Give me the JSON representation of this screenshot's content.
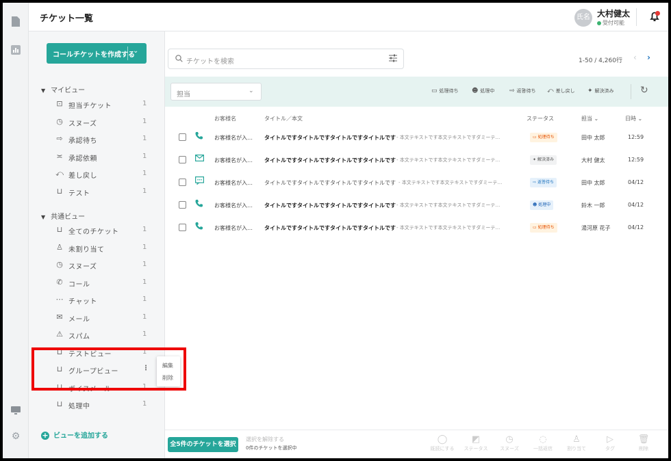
{
  "page_title": "チケット一覧",
  "user": {
    "avatar_text": "氏名",
    "name": "大村健太",
    "status": "受付可能"
  },
  "sidebar": {
    "create_button": "コールチケットを作成する",
    "my_views_label": "マイビュー",
    "my_views": [
      {
        "label": "担当チケット",
        "count": "1",
        "icon": "person-card-icon"
      },
      {
        "label": "スヌーズ",
        "count": "1",
        "icon": "clock-icon"
      },
      {
        "label": "承認待ち",
        "count": "1",
        "icon": "approval-wait-icon"
      },
      {
        "label": "承認依頼",
        "count": "1",
        "icon": "approval-request-icon"
      },
      {
        "label": "差し戻し",
        "count": "1",
        "icon": "return-icon"
      },
      {
        "label": "テスト",
        "count": "1",
        "icon": "inbox-icon"
      }
    ],
    "shared_views_label": "共通ビュー",
    "shared_views": [
      {
        "label": "全てのチケット",
        "count": "1",
        "icon": "inbox-icon"
      },
      {
        "label": "未割り当て",
        "count": "1",
        "icon": "unassigned-icon"
      },
      {
        "label": "スヌーズ",
        "count": "1",
        "icon": "clock-icon"
      },
      {
        "label": "コール",
        "count": "1",
        "icon": "phone-icon"
      },
      {
        "label": "チャット",
        "count": "1",
        "icon": "chat-icon"
      },
      {
        "label": "メール",
        "count": "1",
        "icon": "mail-icon"
      },
      {
        "label": "スパム",
        "count": "1",
        "icon": "warning-icon"
      },
      {
        "label": "テストビュー",
        "count": "1",
        "icon": "inbox-icon"
      },
      {
        "label": "グループビュー",
        "count": "",
        "icon": "inbox-icon"
      },
      {
        "label": "ボイスメール",
        "count": "1",
        "icon": "inbox-icon"
      },
      {
        "label": "処理中",
        "count": "1",
        "icon": "inbox-icon"
      }
    ],
    "context_menu": {
      "edit": "編集",
      "delete": "削除"
    },
    "add_view": "ビューを追加する"
  },
  "search": {
    "placeholder": "チケットを検索"
  },
  "pagination": {
    "range": "1-50 / 4,260行"
  },
  "filters": {
    "assignee": "担当",
    "actions": [
      "処理待ち",
      "処理中",
      "返答待ち",
      "差し戻し",
      "解決済み"
    ]
  },
  "table": {
    "headers": {
      "customer": "お客様名",
      "title": "タイトル／本文",
      "status": "ステータス",
      "assignee": "担当",
      "date": "日時"
    },
    "rows": [
      {
        "channel": "phone",
        "customer": "お客様名が入…",
        "title": "タイトルですタイトルですタイトルですタイトルです",
        "body": "- 本文テキストです本文テキストですダミーテ…",
        "status": "処理待ち",
        "status_type": "wait",
        "assignee": "田中 太郎",
        "time": "12:59",
        "bold": true
      },
      {
        "channel": "mail",
        "customer": "お客様名が入…",
        "title": "タイトルですタイトルですタイトルですタイトルです",
        "body": "- 本文テキストです本文テキストですダミーテ…",
        "status": "解決済み",
        "status_type": "done",
        "assignee": "大村 健太",
        "time": "12:59",
        "bold": true
      },
      {
        "channel": "chat",
        "customer": "お客様名が入…",
        "title": "タイトルですタイトルですタイトルですタイトルです",
        "body": "- 本文テキストです本文テキストですダミーテ…",
        "status": "返答待ち",
        "status_type": "reply",
        "assignee": "田中 太郎",
        "time": "04/12",
        "bold": false
      },
      {
        "channel": "phone",
        "customer": "お客様名が入…",
        "title": "タイトルですタイトルですタイトルですタイトルです",
        "body": "- 本文テキストです本文テキストですダミーテ…",
        "status": "処理中",
        "status_type": "prog",
        "assignee": "鈴木 一郎",
        "time": "04/12",
        "bold": true
      },
      {
        "channel": "phone",
        "customer": "お客様名が入…",
        "title": "タイトルですタイトルですタイトルですタイトルです",
        "body": "- 本文テキストです本文テキストですダミーテ…",
        "status": "処理待ち",
        "status_type": "wait",
        "assignee": "湯河原 花子",
        "time": "04/12",
        "bold": true
      }
    ]
  },
  "bottom": {
    "select_all": "全5件のチケットを選択",
    "clear_selection": "選択を解除する",
    "selected_count": "0件のチケットを選択中",
    "actions": [
      "既読にする",
      "ステータス",
      "スヌーズ",
      "一括返信",
      "割り当て",
      "タグ",
      "削除"
    ]
  },
  "colors": {
    "accent": "#26a69a",
    "filter_bg": "#e6f3f1",
    "highlight": "#ee0000"
  }
}
